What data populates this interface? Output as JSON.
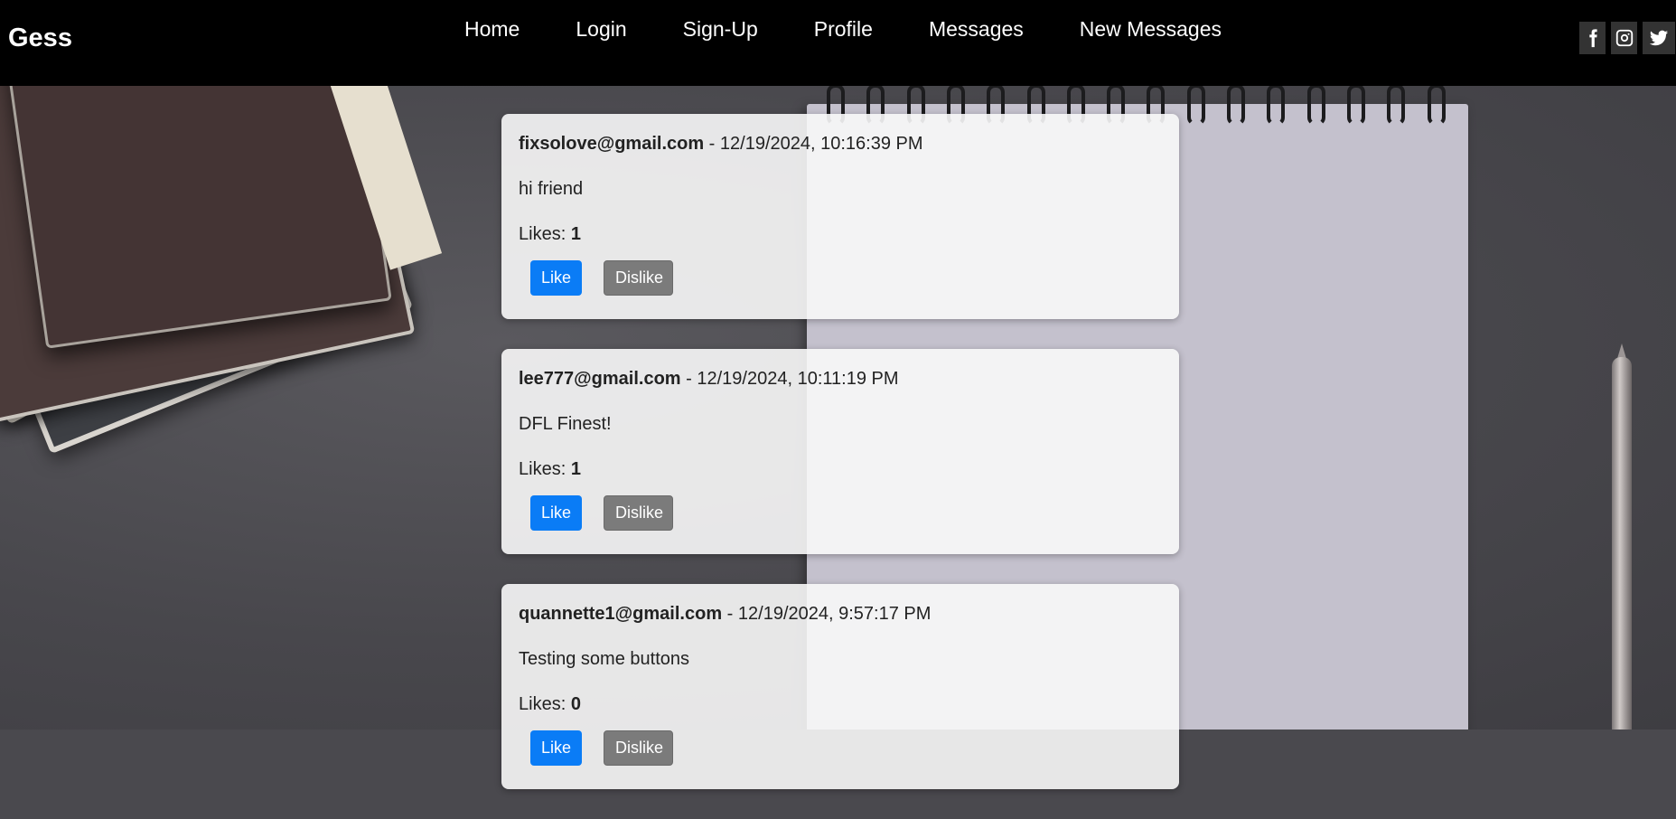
{
  "brand": "Gess",
  "nav": [
    "Home",
    "Login",
    "Sign-Up",
    "Profile",
    "Messages",
    "New Messages"
  ],
  "social": [
    "facebook-icon",
    "instagram-icon",
    "twitter-icon"
  ],
  "buttons": {
    "like": "Like",
    "dislike": "Dislike"
  },
  "likes_label": "Likes: ",
  "messages": [
    {
      "email": "fixsolove@gmail.com",
      "sep": " - ",
      "timestamp": "12/19/2024, 10:16:39 PM",
      "text": "hi friend",
      "likes": "1"
    },
    {
      "email": "lee777@gmail.com",
      "sep": " - ",
      "timestamp": "12/19/2024, 10:11:19 PM",
      "text": "DFL Finest!",
      "likes": "1"
    },
    {
      "email": "quannette1@gmail.com",
      "sep": " - ",
      "timestamp": "12/19/2024, 9:57:17 PM",
      "text": "Testing some buttons",
      "likes": "0"
    }
  ]
}
